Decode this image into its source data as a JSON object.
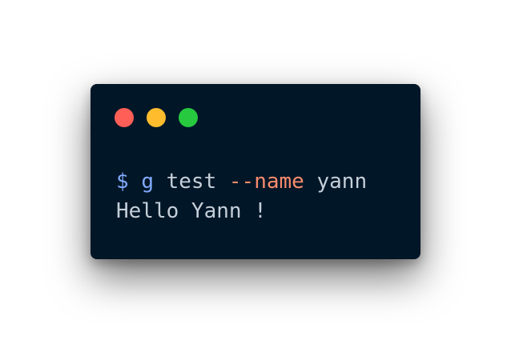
{
  "window": {
    "buttons": [
      {
        "name": "close",
        "color": "#ff5f56"
      },
      {
        "name": "minimize",
        "color": "#ffbd2e"
      },
      {
        "name": "zoom",
        "color": "#27c93f"
      }
    ],
    "background": "#011627"
  },
  "terminal": {
    "command": {
      "prompt": "$",
      "program": "g",
      "argument": "test",
      "flag": "--name",
      "value": "yann"
    },
    "output": "Hello Yann !"
  }
}
